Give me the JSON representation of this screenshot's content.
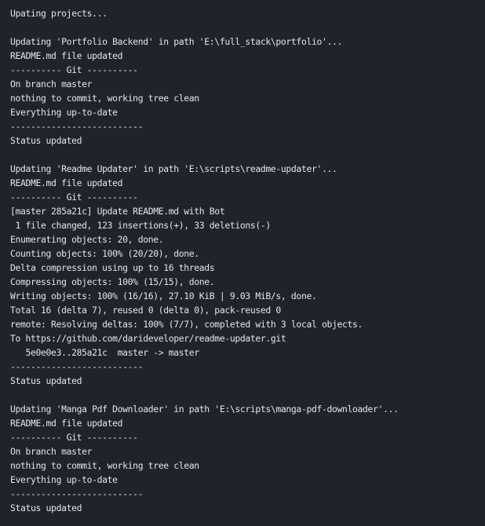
{
  "terminal": {
    "header": "Upating projects...",
    "projects": [
      {
        "updating": "Updating 'Portfolio Backend' in path 'E:\\full_stack\\portfolio'...",
        "readme": "README.md file updated",
        "git_header": "---------- Git ----------",
        "git_output": [
          "On branch master",
          "nothing to commit, working tree clean",
          "Everything up-to-date"
        ],
        "separator": "--------------------------",
        "status": "Status updated"
      },
      {
        "updating": "Updating 'Readme Updater' in path 'E:\\scripts\\readme-updater'...",
        "readme": "README.md file updated",
        "git_header": "---------- Git ----------",
        "git_output": [
          "[master 285a21c] Update README.md with Bot",
          " 1 file changed, 123 insertions(+), 33 deletions(-)",
          "Enumerating objects: 20, done.",
          "Counting objects: 100% (20/20), done.",
          "Delta compression using up to 16 threads",
          "Compressing objects: 100% (15/15), done.",
          "Writing objects: 100% (16/16), 27.10 KiB | 9.03 MiB/s, done.",
          "Total 16 (delta 7), reused 0 (delta 0), pack-reused 0",
          "remote: Resolving deltas: 100% (7/7), completed with 3 local objects.",
          "To https://github.com/darideveloper/readme-updater.git",
          "   5e0e0e3..285a21c  master -> master"
        ],
        "separator": "--------------------------",
        "status": "Status updated"
      },
      {
        "updating": "Updating 'Manga Pdf Downloader' in path 'E:\\scripts\\manga-pdf-downloader'...",
        "readme": "README.md file updated",
        "git_header": "---------- Git ----------",
        "git_output": [
          "On branch master",
          "nothing to commit, working tree clean",
          "Everything up-to-date"
        ],
        "separator": "--------------------------",
        "status": "Status updated"
      }
    ]
  }
}
